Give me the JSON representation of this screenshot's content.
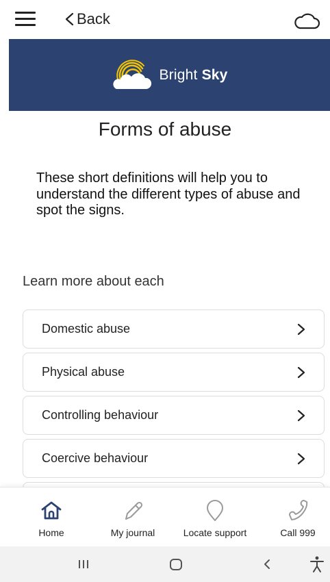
{
  "header": {
    "back_label": "Back",
    "icons": {
      "menu": "hamburger-menu-icon",
      "cloud": "cloud-icon"
    }
  },
  "banner": {
    "brand_regular": "Bright ",
    "brand_bold": "Sky",
    "background": "#2c4372",
    "logo_colors": [
      "#f5c400",
      "#ffffff"
    ]
  },
  "page": {
    "title": "Forms of abuse",
    "intro": "These short definitions will help you to understand the different types of abuse and spot the signs.",
    "section_label": "Learn more about each"
  },
  "abuse_types": [
    "Domestic abuse",
    "Physical abuse",
    "Controlling behaviour",
    "Coercive behaviour"
  ],
  "bottom_nav": {
    "items": [
      {
        "label": "Home",
        "icon": "home-icon",
        "color": "#2c4372"
      },
      {
        "label": "My journal",
        "icon": "pencil-icon",
        "color": "#9a9a9a"
      },
      {
        "label": "Locate support",
        "icon": "location-pin-icon",
        "color": "#9a9a9a"
      },
      {
        "label": "Call 999",
        "icon": "phone-icon",
        "color": "#9a9a9a"
      }
    ]
  },
  "system_nav": {
    "icons": [
      "recent-apps-icon",
      "home-circle-icon",
      "back-arrow-icon",
      "accessibility-icon"
    ]
  }
}
